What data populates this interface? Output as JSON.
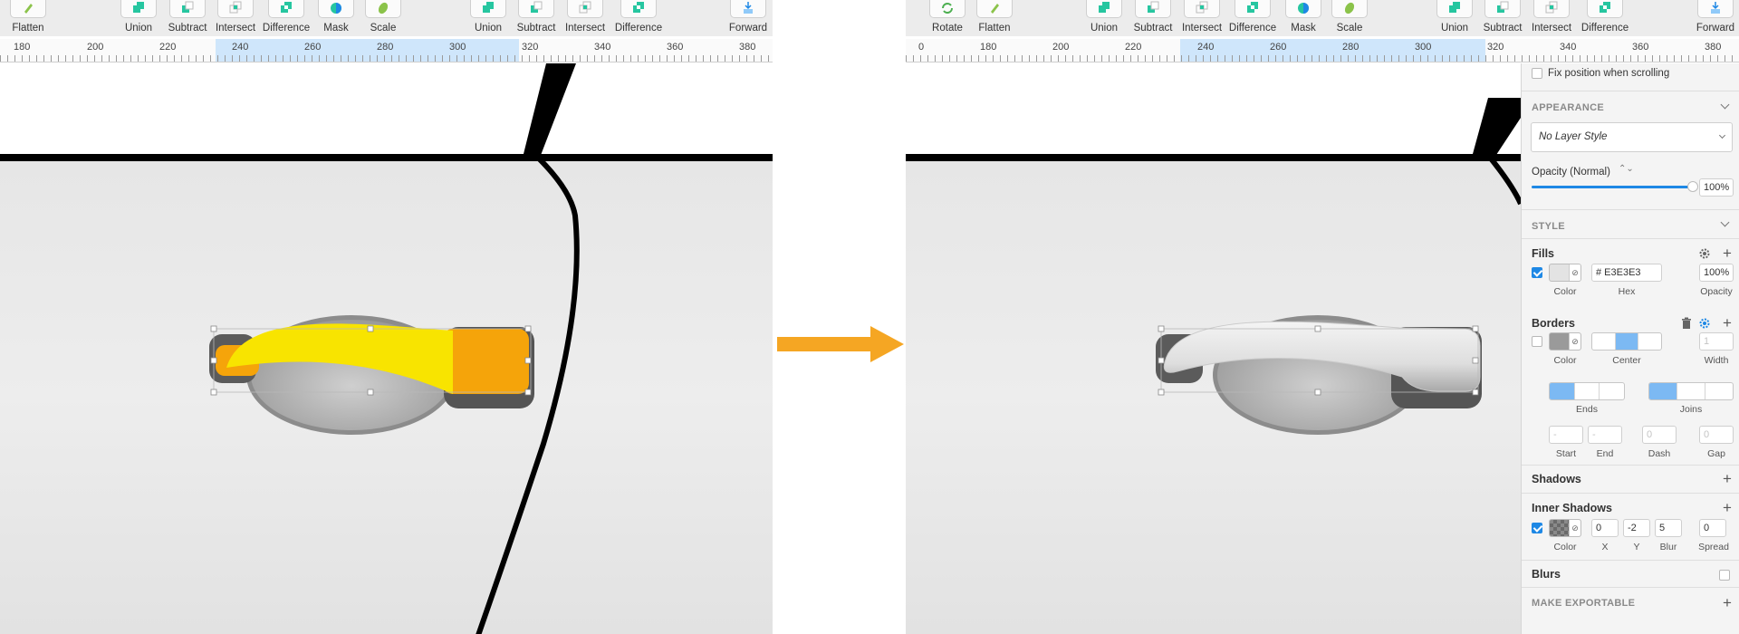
{
  "left_toolbar": {
    "items": [
      {
        "label": "Flatten",
        "icon": "flatten-icon"
      },
      {
        "label": "Union",
        "icon": "union-icon"
      },
      {
        "label": "Subtract",
        "icon": "subtract-icon"
      },
      {
        "label": "Intersect",
        "icon": "intersect-icon"
      },
      {
        "label": "Difference",
        "icon": "difference-icon"
      },
      {
        "label": "Mask",
        "icon": "mask-icon"
      },
      {
        "label": "Scale",
        "icon": "scale-icon"
      },
      {
        "label": "Union",
        "icon": "union-icon"
      },
      {
        "label": "Subtract",
        "icon": "subtract-icon"
      },
      {
        "label": "Intersect",
        "icon": "intersect-icon"
      },
      {
        "label": "Difference",
        "icon": "difference-icon"
      },
      {
        "label": "Forward",
        "icon": "forward-icon"
      }
    ]
  },
  "right_toolbar": {
    "items": [
      {
        "label": "Rotate",
        "icon": "rotate-icon"
      },
      {
        "label": "Flatten",
        "icon": "flatten-icon"
      },
      {
        "label": "Union",
        "icon": "union-icon"
      },
      {
        "label": "Subtract",
        "icon": "subtract-icon"
      },
      {
        "label": "Intersect",
        "icon": "intersect-icon"
      },
      {
        "label": "Difference",
        "icon": "difference-icon"
      },
      {
        "label": "Mask",
        "icon": "mask-icon"
      },
      {
        "label": "Scale",
        "icon": "scale-icon"
      },
      {
        "label": "Union",
        "icon": "union-icon"
      },
      {
        "label": "Subtract",
        "icon": "subtract-icon"
      },
      {
        "label": "Intersect",
        "icon": "intersect-icon"
      },
      {
        "label": "Difference",
        "icon": "difference-icon"
      },
      {
        "label": "Forward",
        "icon": "forward-icon"
      }
    ]
  },
  "left_ruler": {
    "ticks": [
      "180",
      "200",
      "220",
      "240",
      "260",
      "280",
      "300",
      "320",
      "340",
      "360",
      "380"
    ]
  },
  "right_ruler": {
    "ticks": [
      "0",
      "180",
      "200",
      "220",
      "240",
      "260",
      "280",
      "300",
      "320",
      "340",
      "360",
      "380"
    ]
  },
  "inspector": {
    "fix_position_label": "Fix position when scrolling",
    "appearance_title": "APPEARANCE",
    "layer_style_value": "No Layer Style",
    "opacity_label": "Opacity (Normal)",
    "opacity_value": "100%",
    "opacity_fraction": 1.0,
    "style_title": "STYLE",
    "fills_title": "Fills",
    "fill": {
      "enabled": true,
      "hex": "# E3E3E3",
      "opacity": "100%",
      "color_label": "Color",
      "hex_label": "Hex",
      "opacity_label": "Opacity",
      "swatch_color": "#e3e3e3"
    },
    "borders_title": "Borders",
    "border": {
      "enabled": false,
      "color_label": "Color",
      "position_label": "Center",
      "width_label": "Width",
      "width_value": "1",
      "swatch_color": "#9a9a9a"
    },
    "ends_label": "Ends",
    "joins_label": "Joins",
    "start_label": "Start",
    "end_label": "End",
    "dash_label": "Dash",
    "gap_label": "Gap",
    "start_value": "-",
    "end_value": "-",
    "dash_value": "0",
    "gap_value": "0",
    "shadows_title": "Shadows",
    "inner_shadows_title": "Inner Shadows",
    "inner_shadow": {
      "enabled": true,
      "x": "0",
      "y": "-2",
      "blur": "5",
      "spread": "0",
      "color_label": "Color",
      "x_label": "X",
      "y_label": "Y",
      "blur_label": "Blur",
      "spread_label": "Spread"
    },
    "blurs_title": "Blurs",
    "exportable_title": "MAKE EXPORTABLE"
  },
  "colors": {
    "accent_blue": "#1e88e5",
    "shape_orange": "#f5a40a",
    "shape_yellow": "#f8e400",
    "arrow_orange": "#f5a623"
  }
}
